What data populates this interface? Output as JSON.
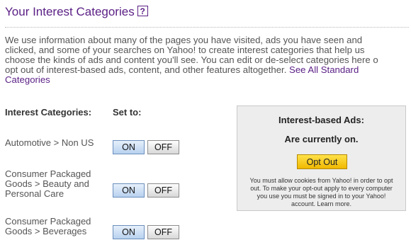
{
  "header": {
    "title": "Your Interest Categories",
    "help_label": "?"
  },
  "intro": {
    "lines": [
      "We use information about many of the pages you have visited, ads you have seen and",
      "clicked, and some of your searches on Yahoo! to create interest categories that help us",
      "choose the kinds of ads and content you'll see. You can edit or de-select categories here o",
      "opt out of interest-based ads, content, and other features altogether. "
    ],
    "link_part1": "See All Standard",
    "link_part2": "Categories"
  },
  "columns": {
    "categories": "Interest Categories:",
    "set_to": "Set to:"
  },
  "categories": [
    {
      "lines": [
        "Automotive > Non US"
      ],
      "on_label": "ON",
      "off_label": "OFF",
      "state": "on"
    },
    {
      "lines": [
        "Consumer Packaged",
        "Goods > Beauty and",
        "Personal Care"
      ],
      "on_label": "ON",
      "off_label": "OFF",
      "state": "on"
    },
    {
      "lines": [
        "Consumer Packaged",
        "Goods > Beverages"
      ],
      "on_label": "ON",
      "off_label": "OFF",
      "state": "on"
    }
  ],
  "ads_box": {
    "title": "Interest-based Ads:",
    "status": "Are currently on.",
    "button_label": "Opt Out",
    "note": "You must allow cookies from Yahoo! in order to opt out. To make your opt-out apply to every computer you use you must be signed in to your Yahoo! account. Learn more."
  },
  "colors": {
    "brand_purple": "#5a1f85",
    "opt_out_yellow": "#ffd21f",
    "on_blue": "#b8d1ef"
  }
}
